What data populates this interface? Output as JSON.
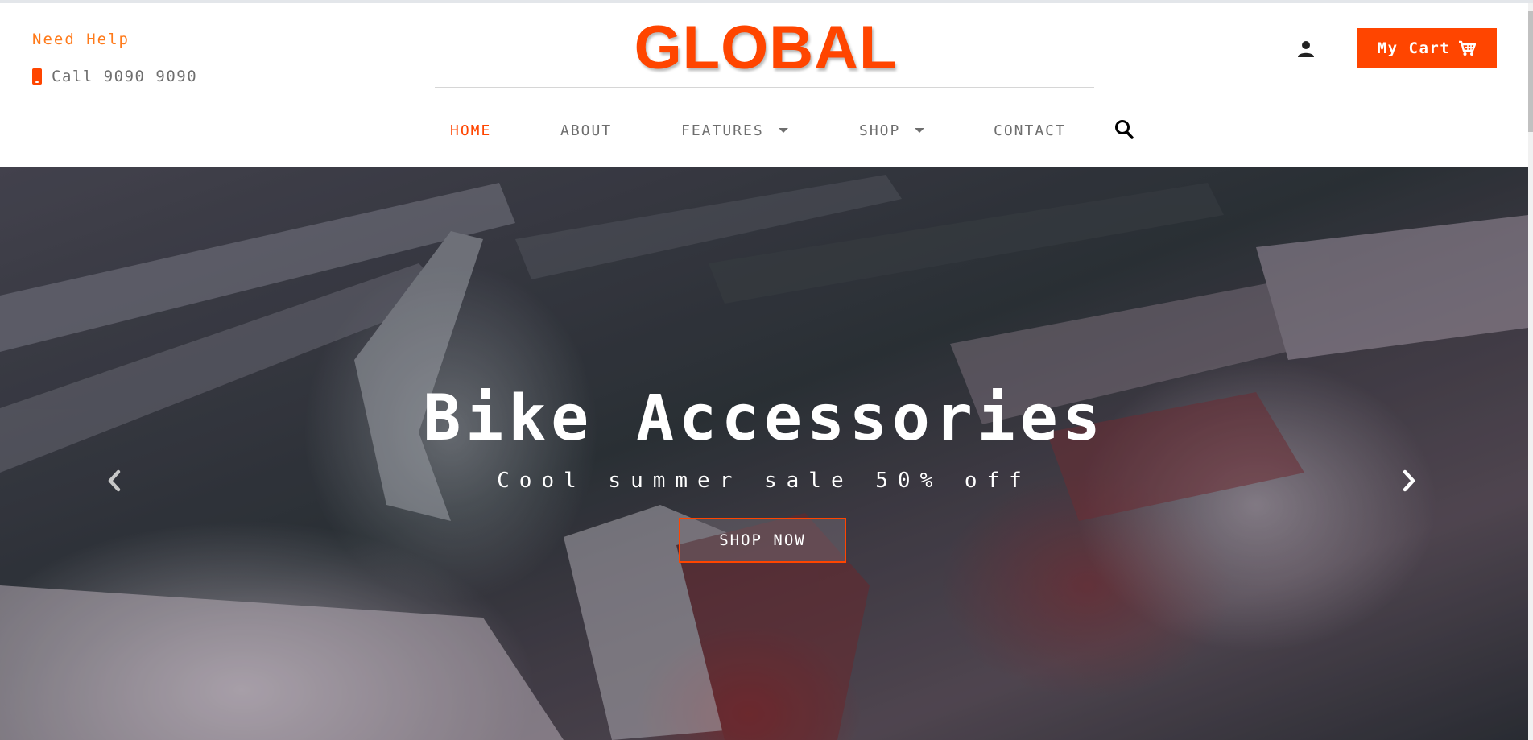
{
  "topbar": {
    "help_text": "Need Help",
    "call_text": "Call 9090 9090"
  },
  "brand": {
    "logo_text": "GLOBAL",
    "accent_color": "#ff4500"
  },
  "nav": {
    "items": [
      {
        "label": "HOME",
        "active": true,
        "has_dropdown": false
      },
      {
        "label": "ABOUT",
        "active": false,
        "has_dropdown": false
      },
      {
        "label": "FEATURES",
        "active": false,
        "has_dropdown": true
      },
      {
        "label": "SHOP",
        "active": false,
        "has_dropdown": true
      },
      {
        "label": "CONTACT",
        "active": false,
        "has_dropdown": false
      }
    ],
    "search_icon": "search-icon"
  },
  "account": {
    "user_icon": "user-icon",
    "cart_label": "My Cart",
    "cart_icon": "shopping-cart-icon"
  },
  "hero": {
    "title": "Bike Accessories",
    "subtitle": "Cool summer sale 50% off",
    "cta_label": "SHOP NOW",
    "prev_icon": "chevron-left-icon",
    "next_icon": "chevron-right-icon"
  }
}
